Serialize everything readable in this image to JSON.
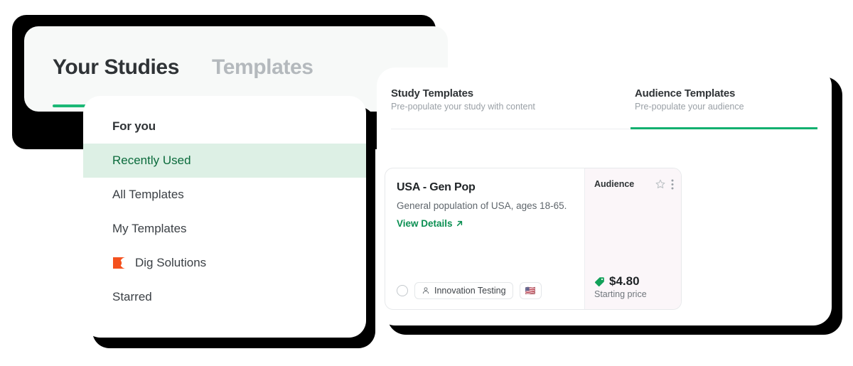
{
  "back_card": {
    "tabs": [
      {
        "label": "Your Studies",
        "active": true
      },
      {
        "label": "Templates",
        "active": false
      }
    ],
    "accent_color": "#1bb876"
  },
  "dropdown": {
    "heading": "For you",
    "items": [
      {
        "label": "Recently Used",
        "active": true,
        "icon": null
      },
      {
        "label": "All Templates",
        "active": false,
        "icon": null
      },
      {
        "label": "My Templates",
        "active": false,
        "icon": null
      },
      {
        "label": "Dig Solutions",
        "active": false,
        "icon": "dig-solutions-logo-icon"
      },
      {
        "label": "Starred",
        "active": false,
        "icon": null
      }
    ],
    "active_bg": "#ddf0e5",
    "active_text": "#0b6b3c",
    "logo_color": "#f4511e"
  },
  "templates_panel": {
    "tabs": [
      {
        "title": "Study Templates",
        "subtitle": "Pre-populate your study with content",
        "active": false
      },
      {
        "title": "Audience Templates",
        "subtitle": "Pre-populate your audience",
        "active": true
      }
    ],
    "active_underline_color": "#12b06f",
    "card": {
      "title": "USA - Gen Pop",
      "description": "General population of USA, ages 18-65.",
      "link_label": "View Details",
      "link_icon": "arrow-up-right-icon",
      "link_color": "#0b8f52",
      "chips": [
        {
          "label": "Innovation Testing",
          "icon": "person-icon"
        },
        {
          "label": "🇺🇸",
          "icon": "us-flag-icon"
        }
      ],
      "side": {
        "label": "Audience",
        "star_icon": "star-outline-icon",
        "menu_icon": "kebab-menu-icon",
        "price": "$4.80",
        "price_caption": "Starting price",
        "price_icon": "price-tag-icon",
        "price_icon_color": "#12a159",
        "background": "#fbf6f9"
      }
    }
  }
}
